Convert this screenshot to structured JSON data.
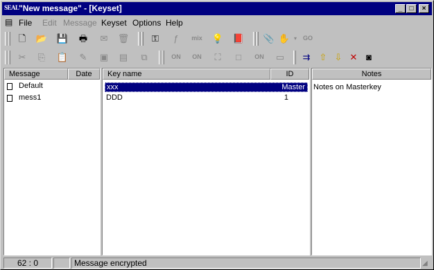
{
  "window": {
    "logo": "SEAL",
    "title": "\"New message\" - [Keyset]"
  },
  "menu": [
    "File",
    "Edit",
    "Message",
    "Keyset",
    "Options",
    "Help"
  ],
  "left_pane": {
    "columns": [
      "Message",
      "Date"
    ],
    "items": [
      "Default",
      "mess1"
    ]
  },
  "key_pane": {
    "columns": [
      "Key name",
      "ID"
    ],
    "rows": [
      {
        "name": "xxx",
        "id": "Master",
        "selected": true
      },
      {
        "name": "DDD",
        "id": "1",
        "selected": false
      }
    ]
  },
  "notes_pane": {
    "header": "Notes",
    "text": "Notes on Masterkey"
  },
  "toolbar_labels": {
    "mix": "mix",
    "on": "ON",
    "go": "GO"
  },
  "status": {
    "position": "62 : 0",
    "message": "Message encrypted"
  },
  "colors": {
    "titlebar": "#000080",
    "selection": "#000080",
    "face": "#c0c0c0"
  }
}
